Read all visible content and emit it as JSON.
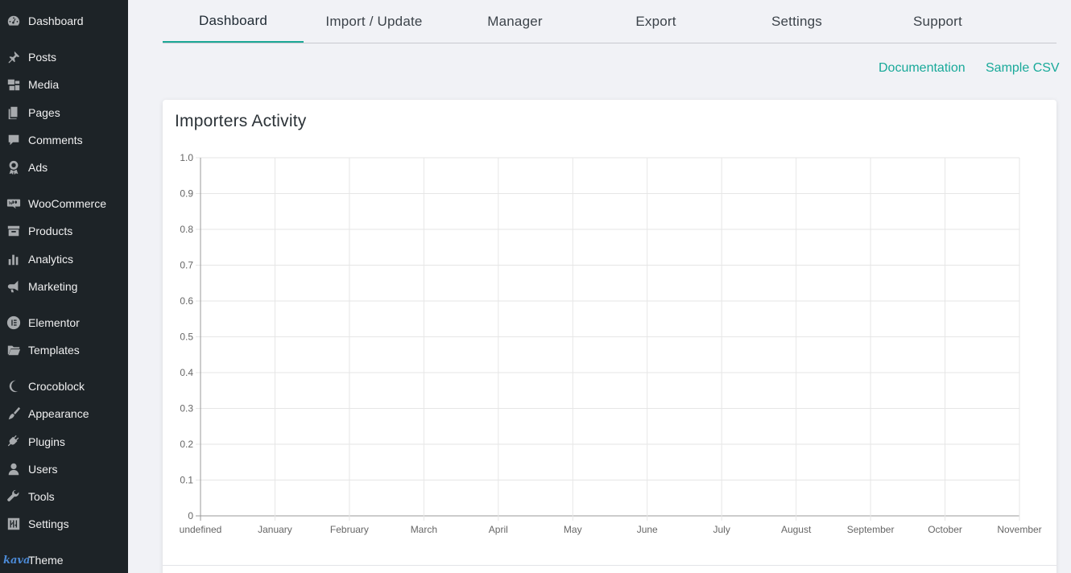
{
  "sidebar": {
    "items": [
      {
        "label": "Dashboard",
        "icon": "dashboard-icon"
      },
      {
        "label": "Posts",
        "icon": "pin-icon"
      },
      {
        "label": "Media",
        "icon": "media-icon"
      },
      {
        "label": "Pages",
        "icon": "pages-icon"
      },
      {
        "label": "Comments",
        "icon": "comment-icon"
      },
      {
        "label": "Ads",
        "icon": "award-icon"
      },
      {
        "label": "WooCommerce",
        "icon": "woo-icon"
      },
      {
        "label": "Products",
        "icon": "archive-icon"
      },
      {
        "label": "Analytics",
        "icon": "bar-chart-icon"
      },
      {
        "label": "Marketing",
        "icon": "megaphone-icon"
      },
      {
        "label": "Elementor",
        "icon": "elementor-icon"
      },
      {
        "label": "Templates",
        "icon": "folder-icon"
      },
      {
        "label": "Crocoblock",
        "icon": "crocoblock-icon"
      },
      {
        "label": "Appearance",
        "icon": "paintbrush-icon"
      },
      {
        "label": "Plugins",
        "icon": "plug-icon"
      },
      {
        "label": "Users",
        "icon": "user-icon"
      },
      {
        "label": "Tools",
        "icon": "wrench-icon"
      },
      {
        "label": "Settings",
        "icon": "sliders-icon"
      }
    ],
    "theme": {
      "logo": "kava",
      "label": "Theme"
    }
  },
  "tabs": [
    {
      "label": "Dashboard",
      "active": true
    },
    {
      "label": "Import / Update",
      "active": false
    },
    {
      "label": "Manager",
      "active": false
    },
    {
      "label": "Export",
      "active": false
    },
    {
      "label": "Settings",
      "active": false
    },
    {
      "label": "Support",
      "active": false
    }
  ],
  "links": {
    "documentation": "Documentation",
    "sample_csv": "Sample CSV"
  },
  "colors": {
    "accent": "#1da896",
    "sidebar_bg": "#1d2327"
  },
  "card": {
    "title": "Importers Activity"
  },
  "chart_data": {
    "type": "line",
    "title": "Importers Activity",
    "categories": [
      "undefined",
      "January",
      "February",
      "March",
      "April",
      "May",
      "June",
      "July",
      "August",
      "September",
      "October",
      "November"
    ],
    "series": [],
    "y_ticks": [
      "0",
      "0.1",
      "0.2",
      "0.3",
      "0.4",
      "0.5",
      "0.6",
      "0.7",
      "0.8",
      "0.9",
      "1.0"
    ],
    "ylim": [
      0,
      1
    ],
    "grid": true,
    "xlabel": "",
    "ylabel": ""
  }
}
